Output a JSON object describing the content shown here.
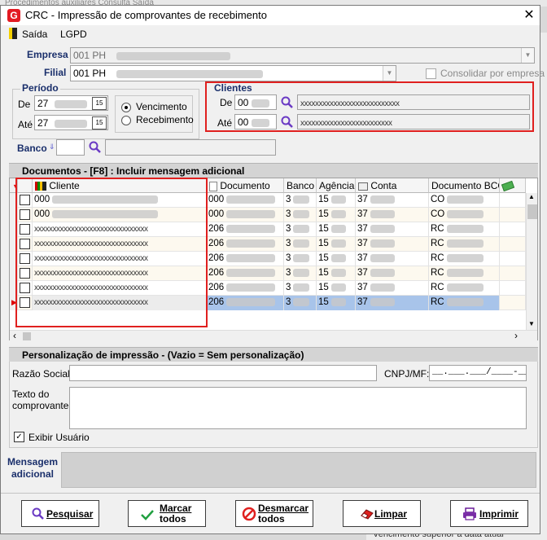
{
  "background_window": {
    "top_text": "Procedimentos auxiliares    Consulta    Saída",
    "bottom_text": "Vencimento superior a data atual"
  },
  "window": {
    "title": "CRC - Impressão de comprovantes de recebimento",
    "close_glyph": "✕"
  },
  "menu": {
    "exit_label": "Saída",
    "lgpd_label": "LGPD"
  },
  "filters": {
    "empresa_label": "Empresa",
    "empresa_value": "001 PH",
    "filial_label": "Filial",
    "filial_value": "001 PH",
    "consolidar_label": "Consolidar por empresa",
    "periodo_title": "Período",
    "de_label": "De",
    "de_value": "27",
    "ate_label": "Até",
    "ate_value": "27",
    "vencimento_label": "Vencimento",
    "recebimento_label": "Recebimento",
    "selected_date_type": "Vencimento",
    "clientes_title": "Clientes",
    "cli_de_label": "De",
    "cli_de_value": "00",
    "cli_de_name": "xxxxxxxxxxxxxxxxxxxxxxxxxxx",
    "cli_ate_label": "Até",
    "cli_ate_value": "00",
    "cli_ate_name": "xxxxxxxxxxxxxxxxxxxxxxxxx",
    "banco_label": "Banco",
    "banco_value": ""
  },
  "documents": {
    "section_title": "Documentos - [F8] : Incluir mensagem adicional",
    "columns": [
      "Cliente",
      "Documento",
      "Banco",
      "Agência",
      "Conta",
      "Documento BCO"
    ],
    "rows": [
      {
        "cliente": "000",
        "documento": "000",
        "banco": "3",
        "agencia": "15",
        "conta": "37",
        "doc_bco": "CO"
      },
      {
        "cliente": "000",
        "documento": "000",
        "banco": "3",
        "agencia": "15",
        "conta": "37",
        "doc_bco": "CO"
      },
      {
        "cliente": "xxxxxxxxxxxxxxxxxxxxxxxxxxxxxxx",
        "documento": "206",
        "banco": "3",
        "agencia": "15",
        "conta": "37",
        "doc_bco": "RC"
      },
      {
        "cliente": "xxxxxxxxxxxxxxxxxxxxxxxxxxxxxxx",
        "documento": "206",
        "banco": "3",
        "agencia": "15",
        "conta": "37",
        "doc_bco": "RC"
      },
      {
        "cliente": "xxxxxxxxxxxxxxxxxxxxxxxxxxxxxxx",
        "documento": "206",
        "banco": "3",
        "agencia": "15",
        "conta": "37",
        "doc_bco": "RC"
      },
      {
        "cliente": "xxxxxxxxxxxxxxxxxxxxxxxxxxxxxxx",
        "documento": "206",
        "banco": "3",
        "agencia": "15",
        "conta": "37",
        "doc_bco": "RC"
      },
      {
        "cliente": "xxxxxxxxxxxxxxxxxxxxxxxxxxxxxxx",
        "documento": "206",
        "banco": "3",
        "agencia": "15",
        "conta": "37",
        "doc_bco": "RC"
      },
      {
        "cliente": "xxxxxxxxxxxxxxxxxxxxxxxxxxxxxxx",
        "documento": "206",
        "banco": "3",
        "agencia": "15",
        "conta": "37",
        "doc_bco": "RC"
      }
    ],
    "selected_row": 7
  },
  "personalizacao": {
    "section_title": "Personalização de impressão - (Vazio = Sem personalização)",
    "razao_label": "Razão Social:",
    "razao_value": "",
    "cnpj_label": "CNPJ/MF:",
    "cnpj_mask": "__.___.___/____-__",
    "texto_label": "Texto do comprovante:",
    "texto_value": "",
    "exibir_label": "Exibir Usuário",
    "exibir_checked": true
  },
  "mensagem": {
    "label": "Mensagem adicional",
    "value": ""
  },
  "buttons": {
    "pesquisar": "Pesquisar",
    "marcar_l1": "Marcar",
    "marcar_l2": "todos",
    "desmarcar_l1": "Desmarcar",
    "desmarcar_l2": "todos",
    "limpar": "Limpar",
    "imprimir": "Imprimir"
  },
  "colors": {
    "highlight_red": "#e0201f",
    "selection_blue": "#a8c4ea",
    "label_blue": "#1a2f6b"
  }
}
